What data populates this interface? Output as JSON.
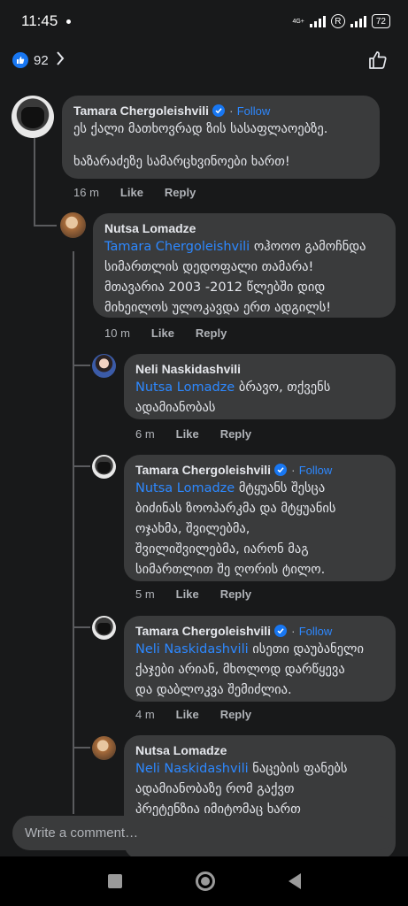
{
  "status_bar": {
    "time": "11:45",
    "network": "4G+",
    "r_badge": "R",
    "battery": "72"
  },
  "reactions": {
    "count": "92",
    "icons": [
      "like-icon",
      "chevron-right-icon",
      "thumbs-up-outline-icon"
    ]
  },
  "comments": [
    {
      "author": "Tamara Chergoleishvili",
      "verified": true,
      "follow_label": "Follow",
      "mention": "",
      "lines": [
        "ეს ქალი მათხოვრად ზის სასაფლაოებზე.",
        "",
        "ხაზარაძეზე სამარცხვინოები ხართ!"
      ],
      "time": "16 m",
      "like_label": "Like",
      "reply_label": "Reply"
    },
    {
      "author": "Nutsa Lomadze",
      "verified": false,
      "mention": "Tamara Chergoleishvili",
      "lines": [
        "Tamara Chergoleishvili ოჰოოო გამოჩნდა",
        "სიმართლის დედოფალი თამარა!",
        "მთავარია 2003 -2012 წლებში დიდ",
        "მიხეილოს ულოკავდა ერთ ადგილს!"
      ],
      "time": "10 m",
      "like_label": "Like",
      "reply_label": "Reply"
    },
    {
      "author": "Neli Naskidashvili",
      "verified": false,
      "mention": "Nutsa Lomadze",
      "lines": [
        "Nutsa Lomadze ბრავო, თქვენს",
        "ადამიანობას"
      ],
      "time": "6 m",
      "like_label": "Like",
      "reply_label": "Reply"
    },
    {
      "author": "Tamara Chergoleishvili",
      "verified": true,
      "follow_label": "Follow",
      "mention": "Nutsa Lomadze",
      "lines": [
        "Nutsa Lomadze  მტყუანს შესცა",
        "ბიძინას ზოოპარკმა და მტყუანის",
        "ოჯახმა, შვილებმა,",
        "შვილიშვილებმა, იარონ მაგ",
        "სიმართლით შე ღორის ტილო."
      ],
      "time": "5 m",
      "like_label": "Like",
      "reply_label": "Reply"
    },
    {
      "author": "Tamara Chergoleishvili",
      "verified": true,
      "follow_label": "Follow",
      "mention": "Neli Naskidashvili",
      "lines": [
        "Neli Naskidashvili  ისეთი დაუბანელი",
        "ქაჯები არიან, მხოლოდ დარწყევა",
        "და დაბლოკვა შემიძლია."
      ],
      "time": "4 m",
      "like_label": "Like",
      "reply_label": "Reply"
    },
    {
      "author": "Nutsa Lomadze",
      "verified": false,
      "mention": "Neli Naskidashvili",
      "lines": [
        "Neli Naskidashvili ნაცების ფანებს",
        "ადამიანობაზე რომ გაქვთ",
        "პრეტენზია იმიტომაც ხართ"
      ],
      "time": "",
      "like_label": "",
      "reply_label": ""
    }
  ],
  "composer": {
    "placeholder": "Write a comment…"
  },
  "colors": {
    "background": "#18191a",
    "bubble": "#3a3b3c",
    "link": "#2d88ff",
    "like_badge": "#1877f2"
  }
}
